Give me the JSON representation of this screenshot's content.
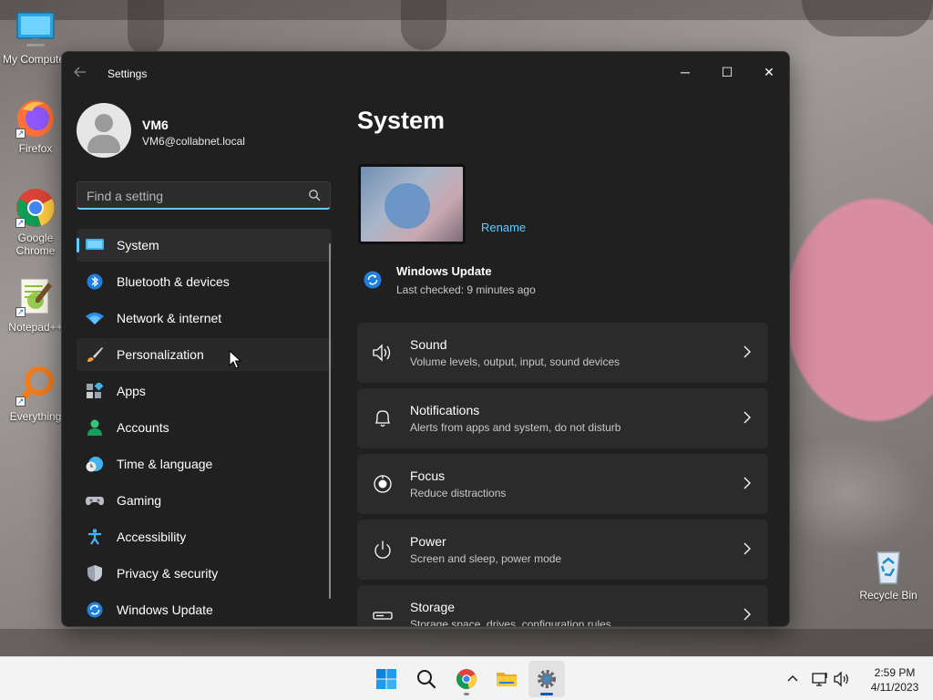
{
  "desktop": {
    "icons": [
      {
        "label": "My Computer"
      },
      {
        "label": "Firefox"
      },
      {
        "label": "Google Chrome"
      },
      {
        "label": "Notepad++"
      },
      {
        "label": "Everything"
      },
      {
        "label": "Recycle Bin"
      }
    ]
  },
  "window": {
    "title": "Settings",
    "controls": {
      "minimize": "─",
      "maximize": "☐",
      "close": "✕"
    }
  },
  "profile": {
    "name": "VM6",
    "email": "VM6@collabnet.local"
  },
  "search": {
    "placeholder": "Find a setting"
  },
  "nav": {
    "items": [
      {
        "label": "System",
        "icon": "system-icon",
        "selected": true
      },
      {
        "label": "Bluetooth & devices",
        "icon": "bluetooth-icon"
      },
      {
        "label": "Network & internet",
        "icon": "wifi-icon"
      },
      {
        "label": "Personalization",
        "icon": "brush-icon",
        "hovered": true
      },
      {
        "label": "Apps",
        "icon": "apps-icon"
      },
      {
        "label": "Accounts",
        "icon": "accounts-icon"
      },
      {
        "label": "Time & language",
        "icon": "clock-globe-icon"
      },
      {
        "label": "Gaming",
        "icon": "gamepad-icon"
      },
      {
        "label": "Accessibility",
        "icon": "accessibility-icon"
      },
      {
        "label": "Privacy & security",
        "icon": "shield-icon"
      },
      {
        "label": "Windows Update",
        "icon": "update-icon"
      }
    ]
  },
  "main": {
    "title": "System",
    "rename_label": "Rename",
    "windows_update": {
      "title": "Windows Update",
      "subtitle": "Last checked: 9 minutes ago"
    },
    "cards": [
      {
        "title": "Sound",
        "subtitle": "Volume levels, output, input, sound devices",
        "icon": "speaker-icon"
      },
      {
        "title": "Notifications",
        "subtitle": "Alerts from apps and system, do not disturb",
        "icon": "bell-icon"
      },
      {
        "title": "Focus",
        "subtitle": "Reduce distractions",
        "icon": "focus-icon"
      },
      {
        "title": "Power",
        "subtitle": "Screen and sleep, power mode",
        "icon": "power-icon"
      },
      {
        "title": "Storage",
        "subtitle": "Storage space, drives, configuration rules",
        "icon": "storage-icon"
      }
    ]
  },
  "taskbar": {
    "time": "2:59 PM",
    "date": "4/11/2023"
  },
  "colors": {
    "accent": "#60cdff",
    "window_bg": "#202020",
    "card_bg": "#2b2b2b"
  }
}
